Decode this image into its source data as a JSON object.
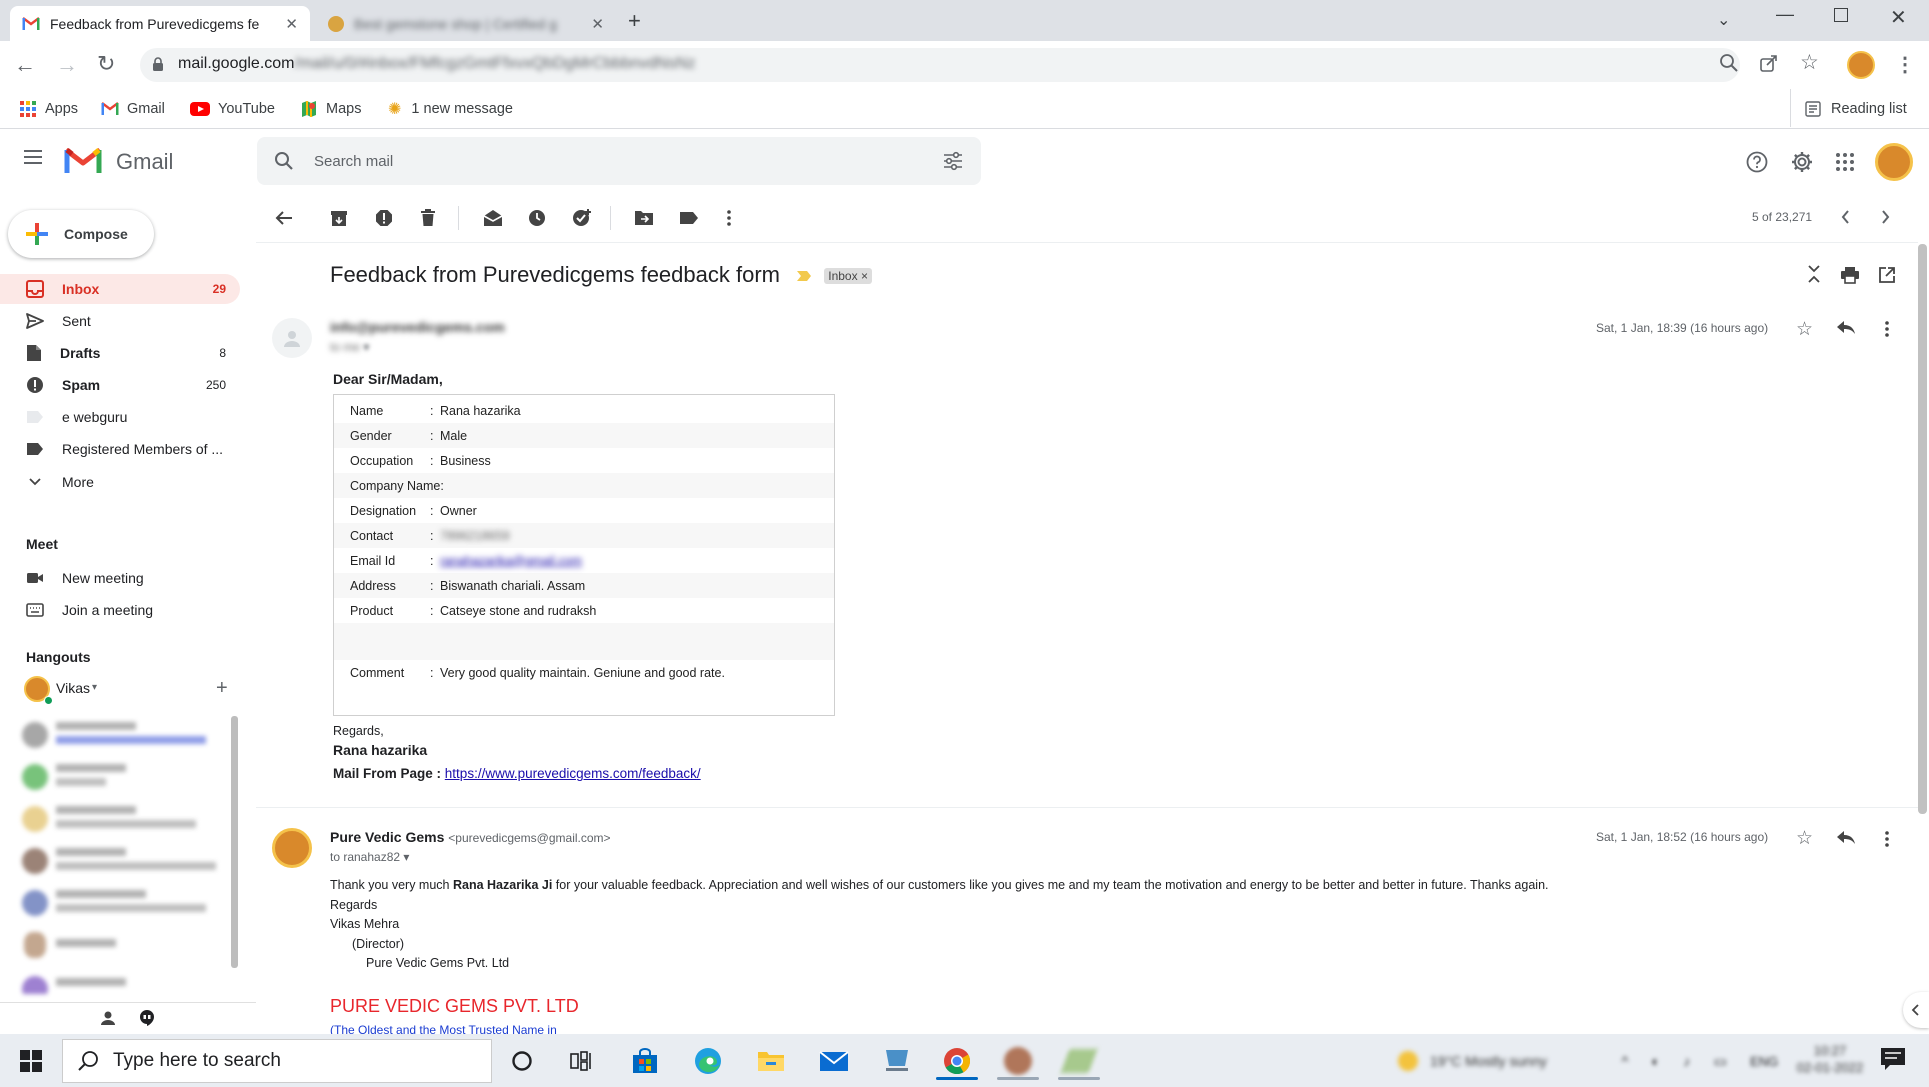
{
  "browser": {
    "tabs": [
      {
        "title": "Feedback from Purevedicgems fe",
        "active": true
      },
      {
        "title": "Best gemstone shop | Certified g",
        "active": false
      }
    ],
    "url_prefix": "mail.google.com",
    "url_rest": "/mail/u/0/#inbox/FMfcgzGmtFfxvxQbDgMrCbbbnvdNsNz",
    "reading_list": "Reading list"
  },
  "bookmarks": [
    {
      "label": "Apps",
      "icon": "apps-grid-icon"
    },
    {
      "label": "Gmail",
      "icon": "gmail-icon"
    },
    {
      "label": "YouTube",
      "icon": "youtube-icon"
    },
    {
      "label": "Maps",
      "icon": "maps-icon"
    },
    {
      "label": "1 new message",
      "icon": "notification-icon"
    }
  ],
  "gmail": {
    "brand": "Gmail",
    "search_placeholder": "Search mail",
    "compose": "Compose",
    "nav": [
      {
        "label": "Inbox",
        "count": "29",
        "icon": "inbox-icon",
        "active": true,
        "bold": true
      },
      {
        "label": "Sent",
        "count": "",
        "icon": "send-icon",
        "active": false,
        "bold": false
      },
      {
        "label": "Drafts",
        "count": "8",
        "icon": "draft-icon",
        "active": false,
        "bold": true
      },
      {
        "label": "Spam",
        "count": "250",
        "icon": "spam-icon",
        "active": false,
        "bold": true
      },
      {
        "label": "e webguru",
        "count": "",
        "icon": "label-icon",
        "active": false,
        "bold": false
      },
      {
        "label": "Registered Members of ...",
        "count": "",
        "icon": "label-icon",
        "active": false,
        "bold": false
      },
      {
        "label": "More",
        "count": "",
        "icon": "chevron-down-icon",
        "active": false,
        "bold": false
      }
    ],
    "meet": {
      "title": "Meet",
      "new_meeting": "New meeting",
      "join_meeting": "Join a meeting"
    },
    "hangouts": {
      "title": "Hangouts",
      "user": "Vikas"
    },
    "pagination": "5 of 23,271"
  },
  "thread": {
    "subject": "Feedback from Purevedicgems feedback form",
    "label": "Inbox",
    "message1": {
      "sender": "info@purevedicgems.com",
      "to": "to me",
      "time": "Sat, 1 Jan, 18:39 (16 hours ago)",
      "greeting": "Dear Sir/Madam,",
      "fields": [
        {
          "key": "Name",
          "value": "Rana hazarika"
        },
        {
          "key": "Gender",
          "value": "Male"
        },
        {
          "key": "Occupation",
          "value": "Business"
        },
        {
          "key": "Company Name:",
          "value": ""
        },
        {
          "key": "Designation",
          "value": "Owner"
        },
        {
          "key": "Contact",
          "value": "7896218659"
        },
        {
          "key": "Email Id",
          "value": "ranahazarika@gmail.com"
        },
        {
          "key": "Address",
          "value": "Biswanath chariali. Assam"
        },
        {
          "key": "Product",
          "value": "Catseye stone and rudraksh"
        }
      ],
      "comment_key": "Comment",
      "comment_value": "Very good quality maintain. Geniune and good rate.",
      "regards": "Regards,",
      "signature": "Rana hazarika",
      "mail_from_label": "Mail From Page :",
      "mail_from_url": "https://www.purevedicgems.com/feedback/"
    },
    "message2": {
      "sender": "Pure Vedic Gems",
      "email": "<purevedicgems@gmail.com>",
      "to": "to ranahaz82",
      "time": "Sat, 1 Jan, 18:52 (16 hours ago)",
      "body_pre": "Thank you very much ",
      "body_bold": "Rana Hazarika Ji",
      "body_post": " for your valuable feedback. Appreciation and well wishes of our customers like you gives me and my team the motivation and energy to be better and better in future. Thanks again.",
      "regards": "Regards",
      "name": "Vikas Mehra",
      "role": "(Director)",
      "company": "Pure Vedic Gems Pvt. Ltd",
      "brand_title": "PURE VEDIC GEMS PVT. LTD",
      "tagline": "(The Oldest and the Most Trusted Name in"
    }
  },
  "taskbar": {
    "search_placeholder": "Type here to search",
    "weather": "19°C Mostly sunny",
    "time": "10:27",
    "date": "02-01-2022",
    "lang": "ENG"
  },
  "colors": {
    "gmail_red": "#d93025",
    "link": "#1a0dab",
    "brand_red": "#e8262c",
    "tagline_blue": "#1a3cd1"
  }
}
